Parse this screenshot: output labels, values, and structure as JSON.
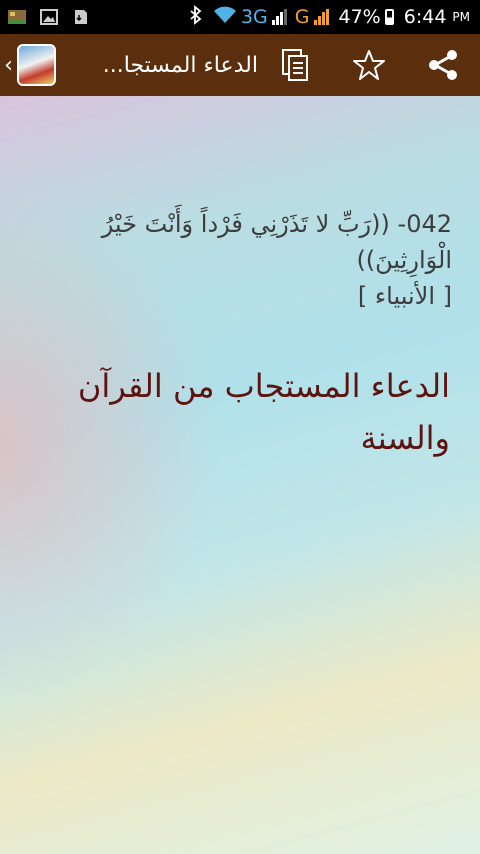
{
  "status_bar": {
    "network": "3G",
    "carrier": "G",
    "battery": "47%",
    "time": "6:44",
    "ampm": "PM"
  },
  "action_bar": {
    "title": "الدعاء المستجا...",
    "up_glyph": "‹",
    "icons": [
      "share-icon",
      "star-icon",
      "copy-icon"
    ]
  },
  "content": {
    "dua_number": "042-",
    "dua_text": "((رَبِّ لا تَذَرْنِي فَرْداً وَأَنْتَ خَيْرُ الْوَارِثِينَ))",
    "surah": "[ الأنبياء ]",
    "headline": "الدعاء المستجاب من القرآن والسنة"
  },
  "colors": {
    "status_bar": "#000000",
    "action_bar": "#5b2f0e",
    "dua_text": "#3d3d3d",
    "headline": "#5d1410"
  }
}
